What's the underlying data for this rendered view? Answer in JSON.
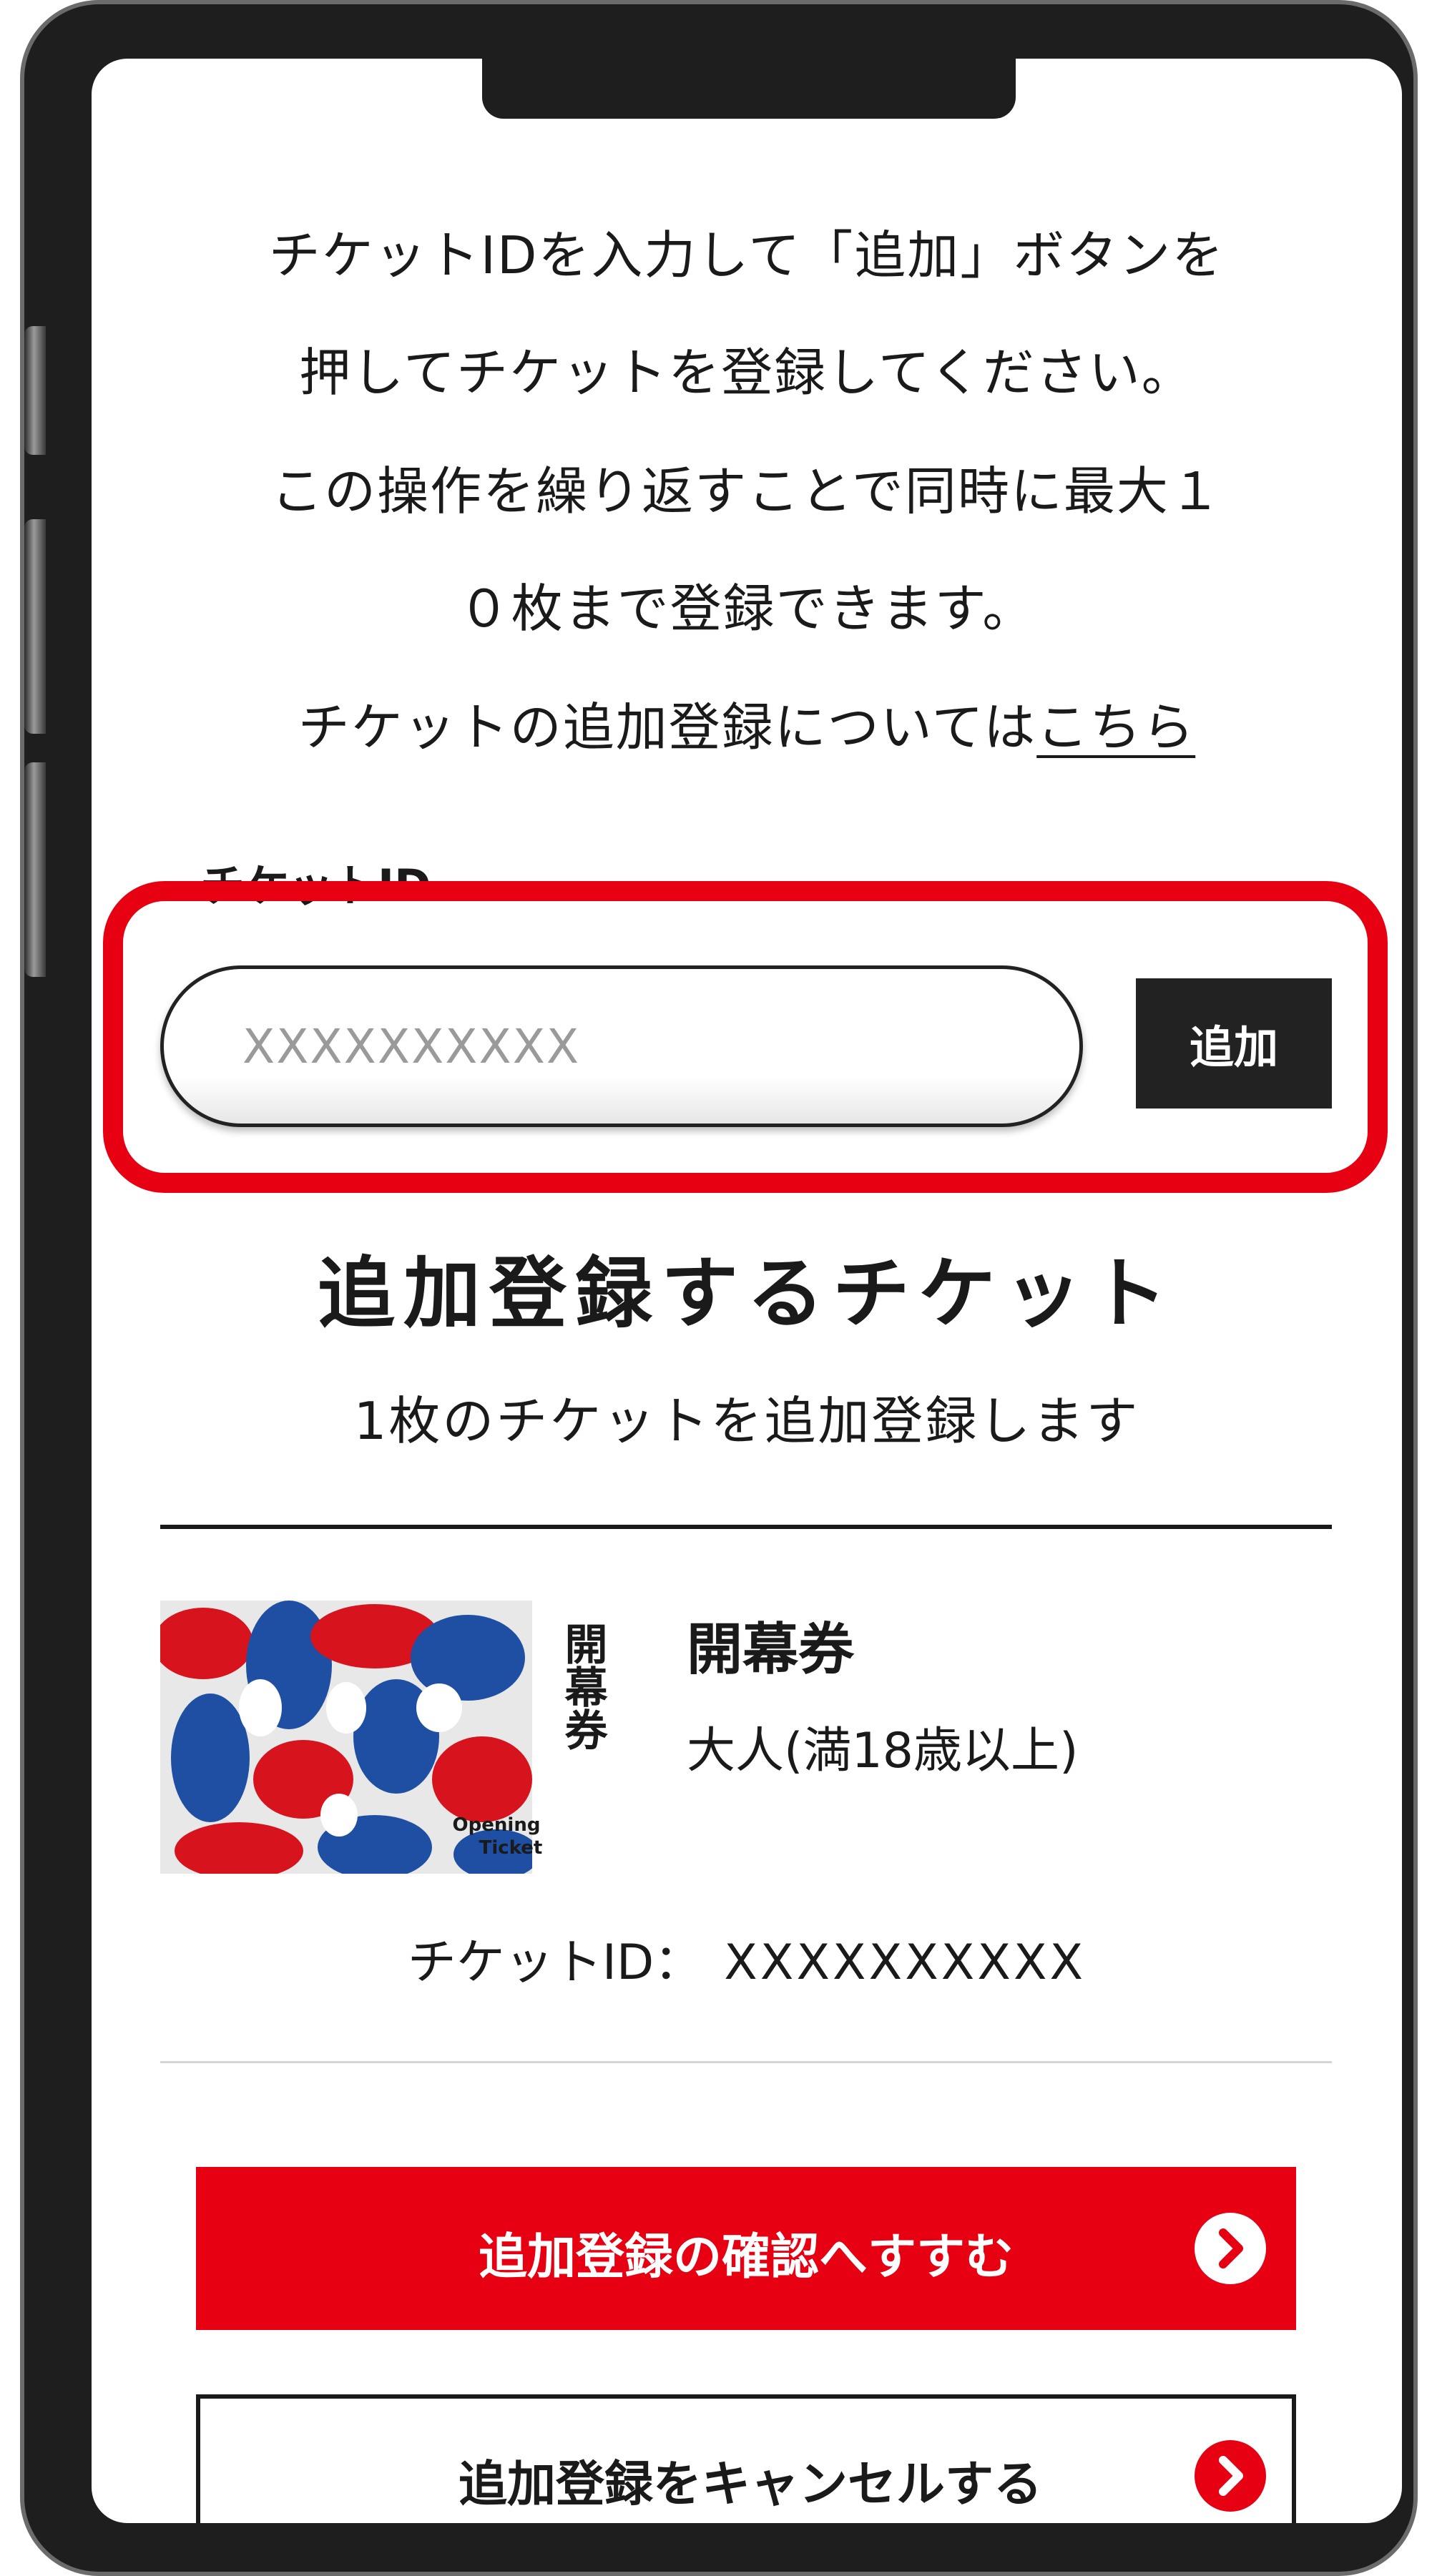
{
  "instructions": {
    "line1": "チケットIDを入力して「追加」ボタンを",
    "line2": "押してチケットを登録してください。",
    "line3": "この操作を繰り返すことで同時に最大１",
    "line4": "０枚まで登録できます。",
    "line5_prefix": "チケットの追加登録については",
    "line5_link": "こちら"
  },
  "ticket_id_field": {
    "label": "チケットID",
    "placeholder": "XXXXXXXXXX",
    "value": ""
  },
  "add_button_label": "追加",
  "section": {
    "title": "追加登録するチケット",
    "subtitle": "1枚のチケットを追加登録します"
  },
  "ticket": {
    "image_text_jp": "開幕券",
    "image_text_en_line1": "Opening",
    "image_text_en_line2": "Ticket",
    "name": "開幕券",
    "type": "大人(満18歳以上)",
    "id_label": "チケットID：",
    "id_value": "XXXXXXXXXX"
  },
  "buttons": {
    "confirm_label": "追加登録の確認へすすむ",
    "cancel_label": "追加登録をキャンセルする"
  },
  "colors": {
    "accent_red": "#e60012",
    "dark": "#222222",
    "highlight": "#e60012"
  },
  "icons": {
    "confirm_arrow": "chevron-right-circle-icon",
    "cancel_arrow": "chevron-right-circle-icon"
  }
}
